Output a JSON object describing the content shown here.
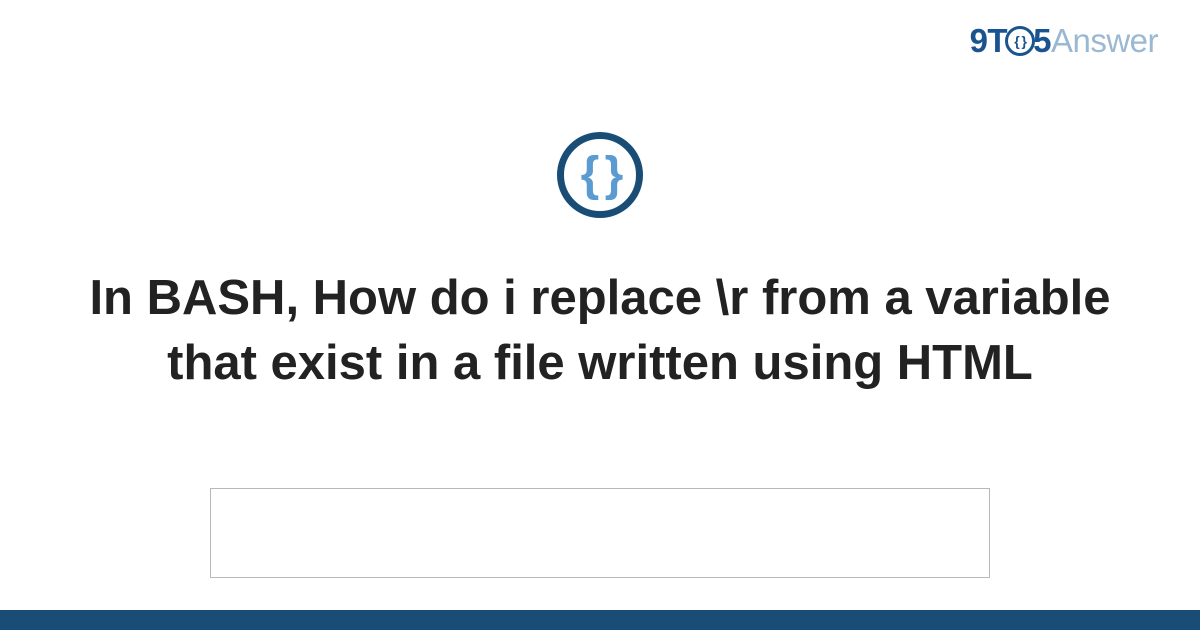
{
  "logo": {
    "part1": "9T",
    "circle_inner": "{ }",
    "part2": "5",
    "part3": "Answer"
  },
  "icon": {
    "braces": "{ }",
    "semantic": "code-braces-icon"
  },
  "title": "In BASH, How do i replace \\r from a variable that exist in a file written using HTML",
  "colors": {
    "brand_dark_blue": "#1a4d75",
    "brand_blue": "#1a5490",
    "brand_light_blue": "#5c9bd1",
    "logo_light": "#9bb8d3",
    "text": "#222222",
    "border_gray": "#b8b8b8"
  }
}
